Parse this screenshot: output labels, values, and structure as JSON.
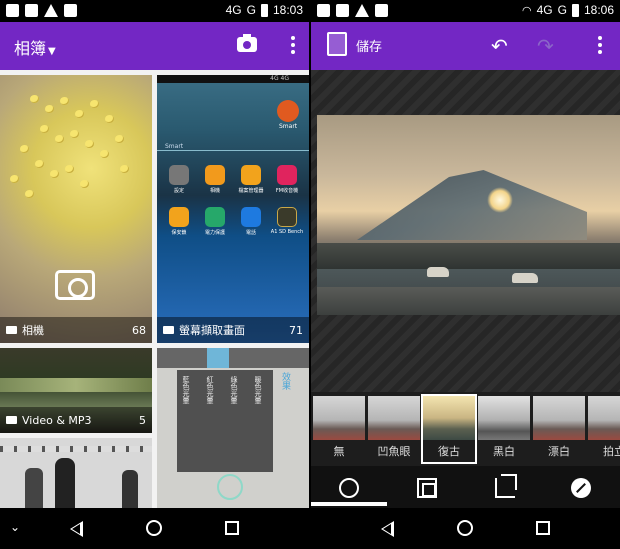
{
  "left": {
    "status": {
      "network": "4G",
      "network_sup": "4G",
      "signal_label": "G",
      "time": "18:03"
    },
    "appbar": {
      "title": "相簿"
    },
    "albums": [
      {
        "name": "相機",
        "count": "68"
      },
      {
        "name": "螢幕擷取畫面",
        "count": "71"
      },
      {
        "name": "Video & MP3",
        "count": "5"
      }
    ],
    "screenshot_tile": {
      "smart_label": "Smart",
      "apps": [
        "設定",
        "相機",
        "檔案管理器",
        "FM收音機",
        "保安鎖",
        "電力保護",
        "電話",
        "A1 SD Bench"
      ],
      "mini_status": "4G 4G"
    },
    "effects_tile": {
      "header": "效果",
      "columns": [
        "藍色光暈",
        "紅色光暈",
        "綠色光暈",
        "暖色光暈"
      ]
    }
  },
  "right": {
    "status": {
      "network": "4G",
      "signal_label": "G",
      "time": "18:06"
    },
    "appbar": {
      "save_label": "儲存"
    },
    "filters": [
      {
        "label": "無",
        "selected": false
      },
      {
        "label": "凹魚眼",
        "selected": false
      },
      {
        "label": "復古",
        "selected": true
      },
      {
        "label": "黑白",
        "selected": false
      },
      {
        "label": "漂白",
        "selected": false
      },
      {
        "label": "拍立",
        "selected": false
      }
    ]
  },
  "colors": {
    "appbar": "#7327c4",
    "navbar": "#000000"
  }
}
